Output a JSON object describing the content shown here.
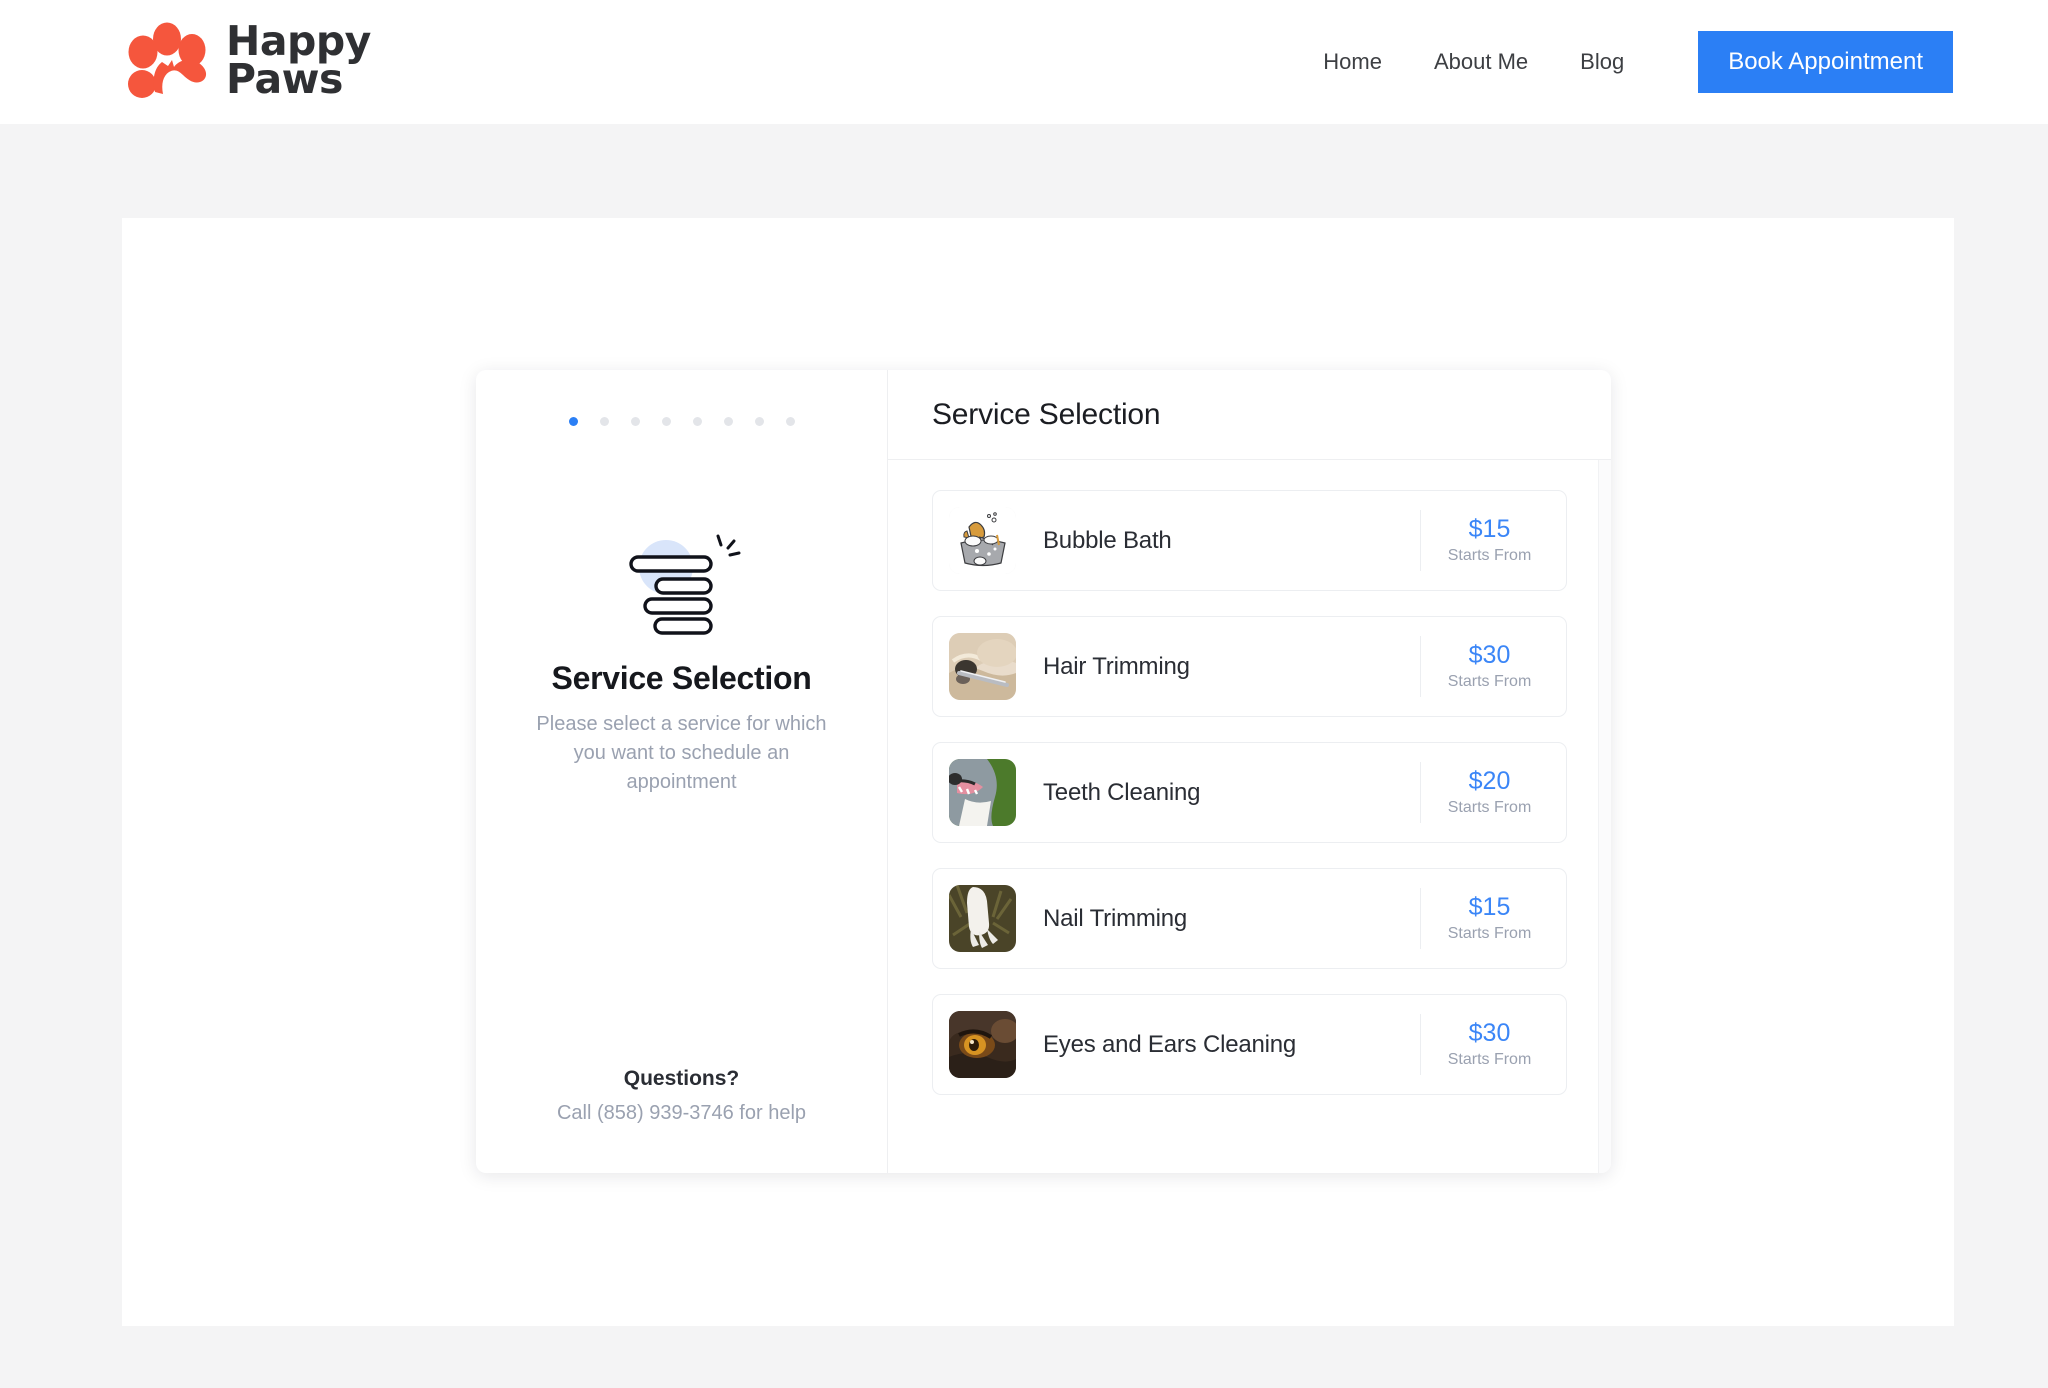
{
  "header": {
    "brand": {
      "line1": "Happy",
      "line2": "Paws",
      "logo_icon": "paw-logo-icon",
      "logo_color": "#f5563d"
    },
    "nav": [
      {
        "label": "Home"
      },
      {
        "label": "About Me"
      },
      {
        "label": "Blog"
      }
    ],
    "cta": {
      "label": "Book Appointment",
      "bg_color": "#2b7ff5",
      "text_color": "#ffffff"
    }
  },
  "widget": {
    "left": {
      "steps": {
        "total": 8,
        "active_index": 0,
        "active_color": "#2b7ff5",
        "inactive_color": "#e3e5e9"
      },
      "illustration_icon": "stacked-list-sparkle-icon",
      "title": "Service Selection",
      "subtitle": "Please select a service for which you want to schedule an appointment",
      "footer_title": "Questions?",
      "footer_text": "Call (858) 939-3746 for help"
    },
    "right": {
      "title": "Service Selection",
      "price_caption": "Starts From",
      "services": [
        {
          "name": "Bubble Bath",
          "price": "$15",
          "caption": "Starts From",
          "thumb_icon": "dog-in-bathtub-illustration"
        },
        {
          "name": "Hair Trimming",
          "price": "$30",
          "caption": "Starts From",
          "thumb_icon": "dog-hair-trimming-photo"
        },
        {
          "name": "Teeth Cleaning",
          "price": "$20",
          "caption": "Starts From",
          "thumb_icon": "dog-teeth-photo"
        },
        {
          "name": "Nail Trimming",
          "price": "$15",
          "caption": "Starts From",
          "thumb_icon": "dog-paw-photo"
        },
        {
          "name": "Eyes and Ears Cleaning",
          "price": "$30",
          "caption": "Starts From",
          "thumb_icon": "dog-eye-photo"
        }
      ]
    }
  }
}
